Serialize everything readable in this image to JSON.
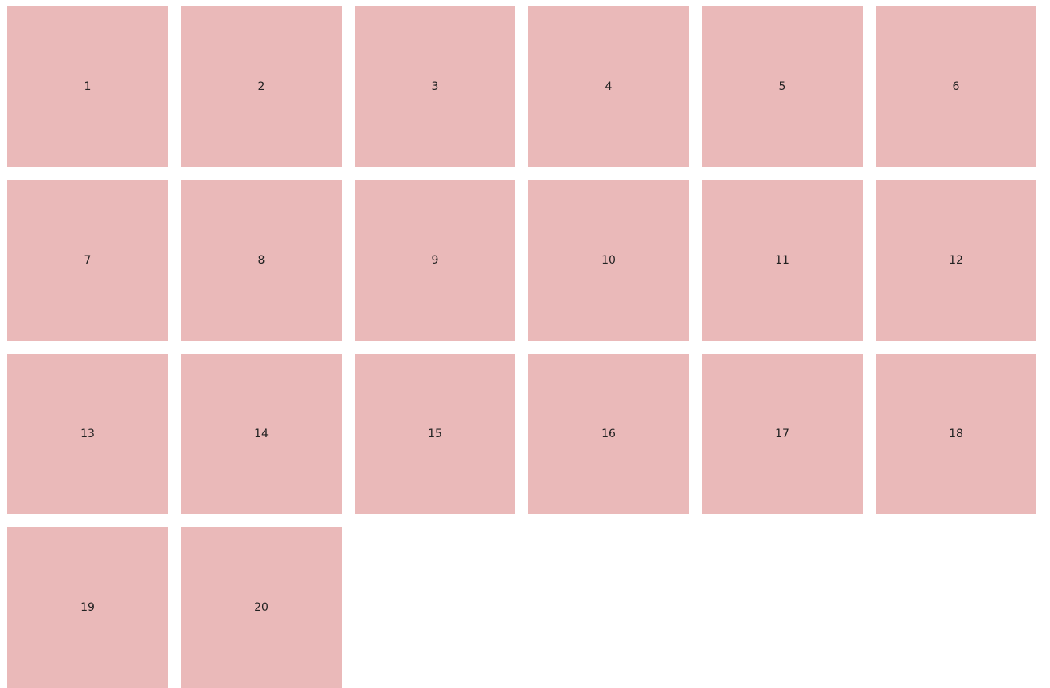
{
  "colors": {
    "background": "#ffffff",
    "tile": "#eab9b9",
    "text": "#222222"
  },
  "tiles": [
    "1",
    "2",
    "3",
    "4",
    "5",
    "6",
    "7",
    "8",
    "9",
    "10",
    "11",
    "12",
    "13",
    "14",
    "15",
    "16",
    "17",
    "18",
    "19",
    "20"
  ]
}
